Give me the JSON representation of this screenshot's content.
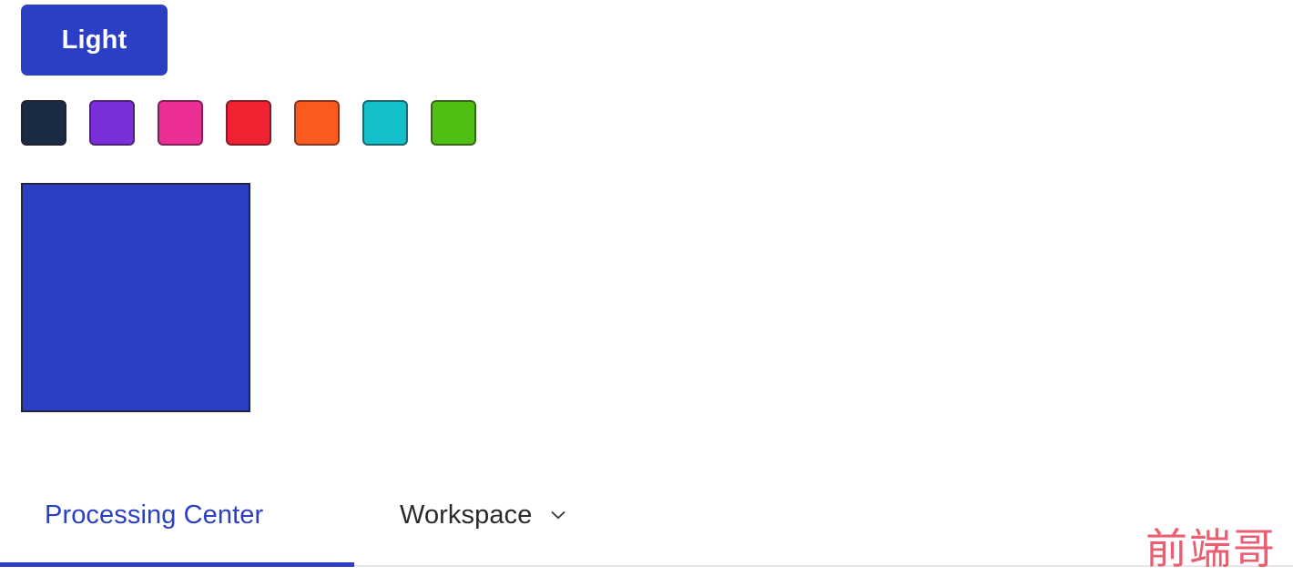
{
  "page": {
    "background_color": "#ffffff"
  },
  "theme_button": {
    "label": "Light",
    "background_color": "#2b3fc4",
    "text_color": "#ffffff"
  },
  "palette": {
    "swatches": [
      {
        "name": "dark",
        "color": "#1b2b44"
      },
      {
        "name": "purple",
        "color": "#7b2fdb"
      },
      {
        "name": "pink",
        "color": "#ed2e95"
      },
      {
        "name": "red",
        "color": "#ef2331"
      },
      {
        "name": "orange",
        "color": "#f95b1e"
      },
      {
        "name": "cyan",
        "color": "#15c0cd"
      },
      {
        "name": "green",
        "color": "#4fc013"
      }
    ]
  },
  "preview": {
    "color": "#2b3fc4",
    "border_color": "#1f2540"
  },
  "tabs": {
    "active_index": 0,
    "active_color": "#2b3fc4",
    "items": [
      {
        "label": "Processing Center",
        "has_chevron": false
      },
      {
        "label": "Workspace",
        "has_chevron": true
      }
    ]
  },
  "watermark": {
    "text": "前端哥",
    "color": "#e8566a"
  }
}
